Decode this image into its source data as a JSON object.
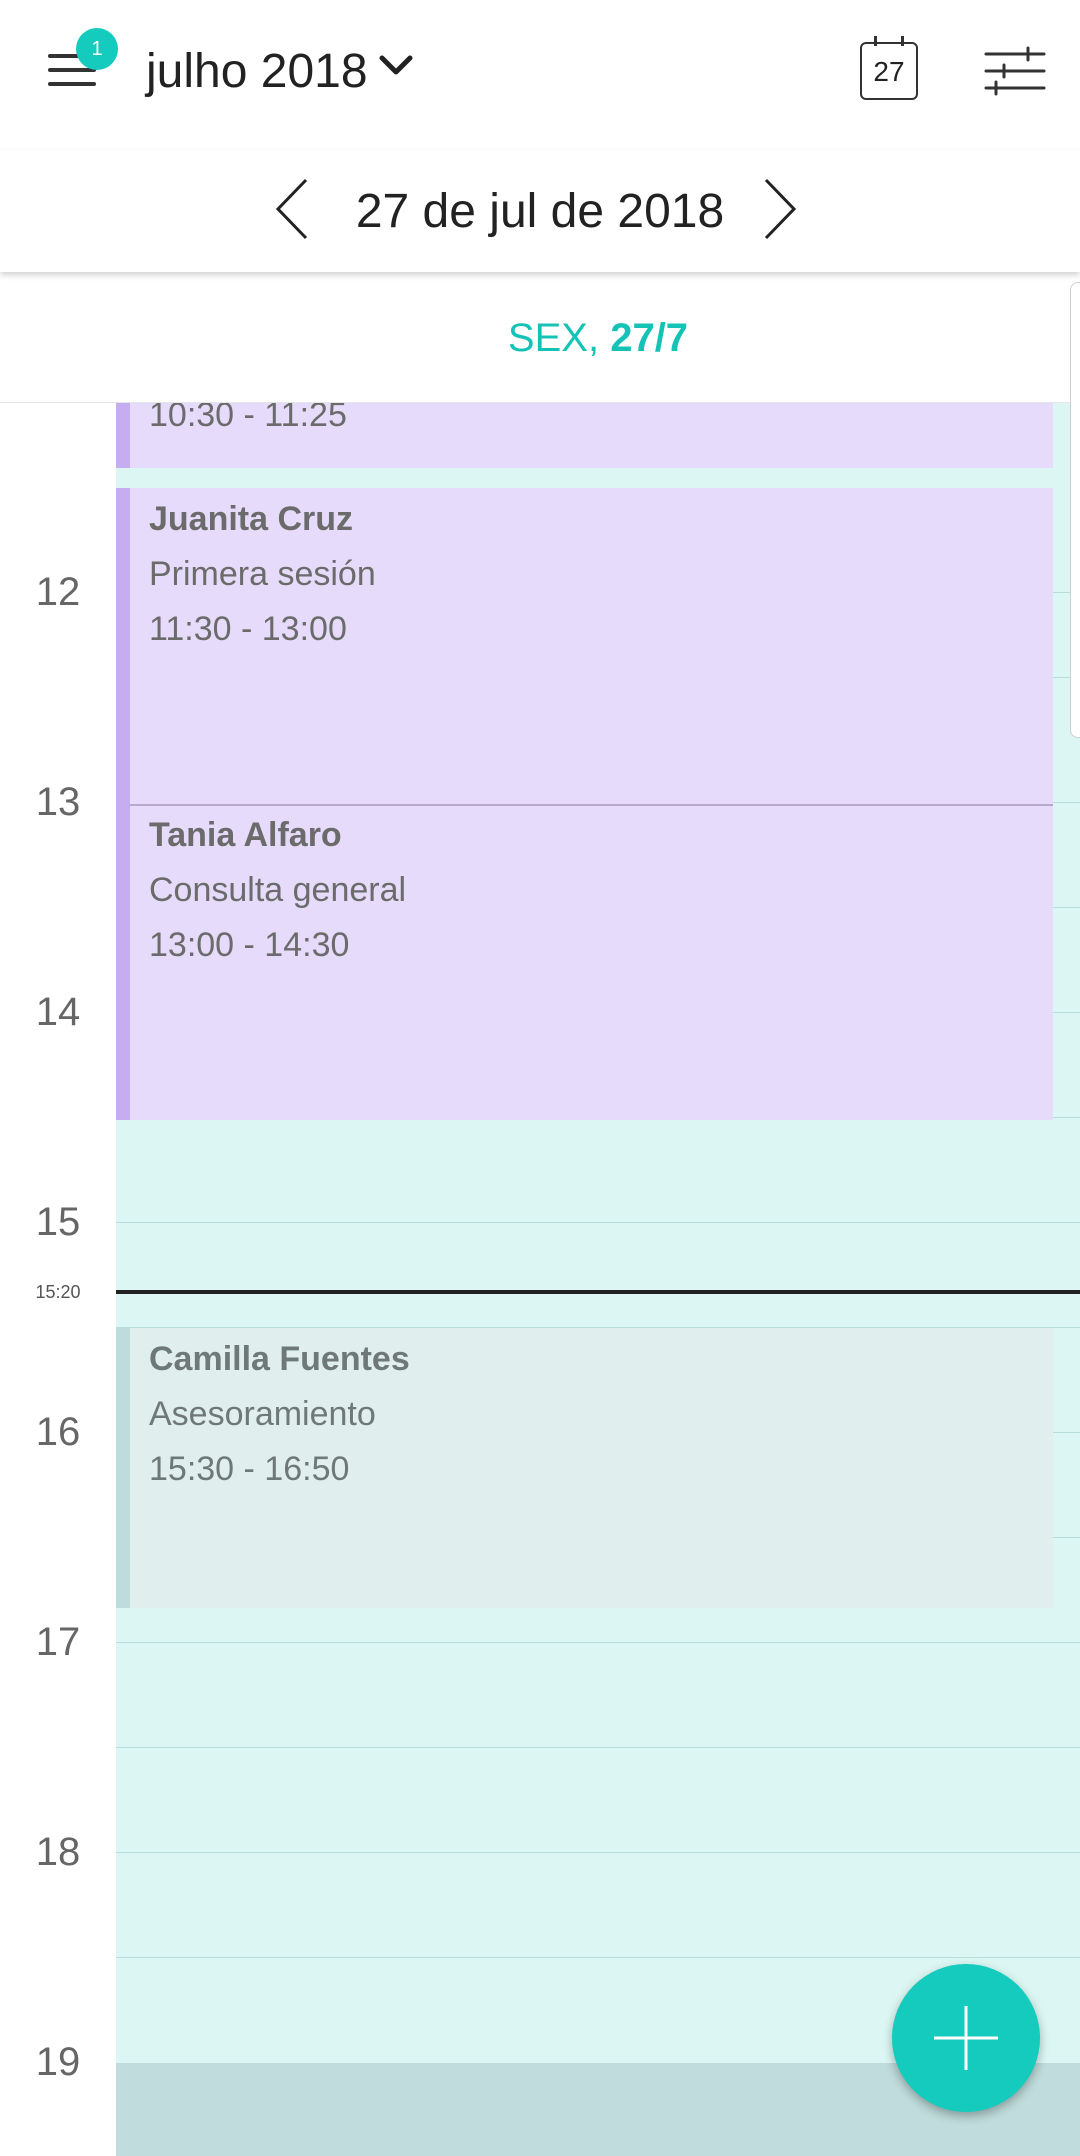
{
  "header": {
    "notification_count": "1",
    "month_title": "julho 2018",
    "today_icon_day": "27"
  },
  "datebar": {
    "title": "27 de jul de 2018"
  },
  "day_header": {
    "weekday": "SEX,",
    "date": "27/7"
  },
  "hours": [
    "12",
    "13",
    "14",
    "15",
    "16",
    "17",
    "18",
    "19"
  ],
  "now": {
    "label": "15:20"
  },
  "events": [
    {
      "name": "",
      "desc": "",
      "time": "10:30 - 11:25",
      "color": "#c6adef"
    },
    {
      "name": "Juanita Cruz",
      "desc": "Primera sesión",
      "time": "11:30 - 13:00",
      "color": "#c6adef"
    },
    {
      "name": "Tania Alfaro",
      "desc": "Consulta general",
      "time": "13:00 - 14:30",
      "color": "#c6adef"
    },
    {
      "name": "Camilla Fuentes",
      "desc": "Asesoramiento",
      "time": "15:30 - 16:50",
      "color": "#bfdcdc"
    }
  ],
  "colors": {
    "accent": "#14cbbd",
    "day_background": "#dcf7f3",
    "event_purple": "#e6dbfa",
    "event_gray": "#e1eeee"
  },
  "icons": {
    "menu": "menu-icon",
    "dropdown": "chevron-down-icon",
    "today": "calendar-icon",
    "filter": "filter-sliders-icon",
    "previous": "chevron-left-icon",
    "next": "chevron-right-icon",
    "add": "plus-icon"
  }
}
